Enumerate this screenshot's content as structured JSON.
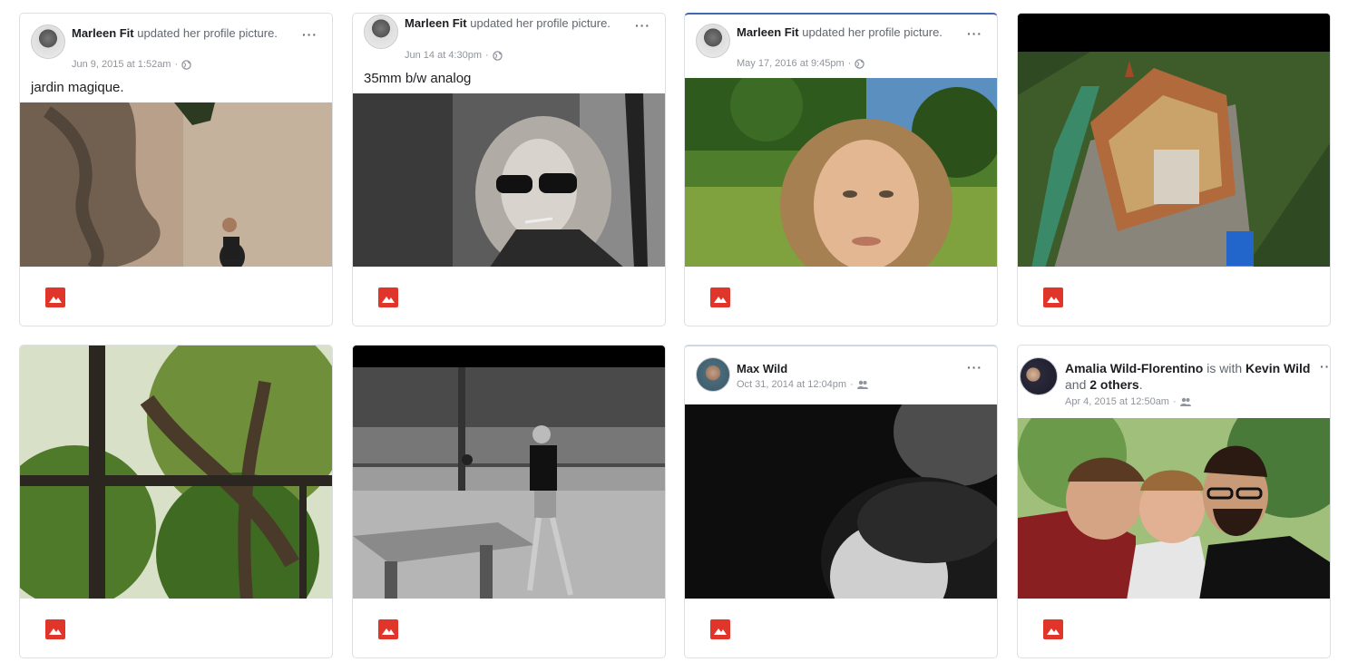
{
  "posts": [
    {
      "author": "Marleen Fit",
      "action": "updated her profile picture.",
      "timestamp": "Jun 9, 2015 at 1:52am",
      "audience_icon": "globe-icon",
      "caption": "jardin magique.",
      "photo_desc": "shadow of leaves on a beige wall, woman sitting at bottom",
      "photo_icon": "photo-icon"
    },
    {
      "author": "Marleen Fit",
      "action": "updated her profile picture.",
      "timestamp": "Jun 14 at 4:30pm",
      "audience_icon": "globe-icon",
      "caption": "35mm b/w analog",
      "photo_desc": "black and white portrait of a woman with sunglasses smoking",
      "photo_icon": "photo-icon"
    },
    {
      "author": "Marleen Fit",
      "action": "updated her profile picture.",
      "timestamp": "May 17, 2016 at 9:45pm",
      "audience_icon": "globe-icon",
      "caption": "",
      "photo_desc": "woman with curly hair in a green park",
      "photo_icon": "photo-icon"
    },
    {
      "photo_desc": "aerial view of a castle surrounded by trees",
      "photo_icon": "photo-icon"
    },
    {
      "photo_desc": "tree branches seen through a window frame",
      "photo_icon": "photo-icon"
    },
    {
      "photo_desc": "black and white photo of man playing table tennis",
      "photo_icon": "photo-icon"
    },
    {
      "author": "Max Wild",
      "timestamp": "Oct 31, 2014 at 12:04pm",
      "audience_icon": "friends-icon",
      "photo_desc": "dark black and white close up of the back of a head",
      "photo_icon": "photo-icon"
    },
    {
      "author": "Amalia Wild-Florentino",
      "with_word": "is with",
      "tagged_1": "Kevin Wild",
      "and_word": "and",
      "tagged_2": "2 others",
      "period": ".",
      "timestamp": "Apr 4, 2015 at 12:50am",
      "audience_icon": "friends-icon",
      "photo_desc": "three young men looking down at something together",
      "photo_icon": "photo-icon"
    }
  ],
  "colors": {
    "accent_icon": "#e0352b",
    "card_border": "#dddfe2",
    "meta_text": "#90949c"
  }
}
